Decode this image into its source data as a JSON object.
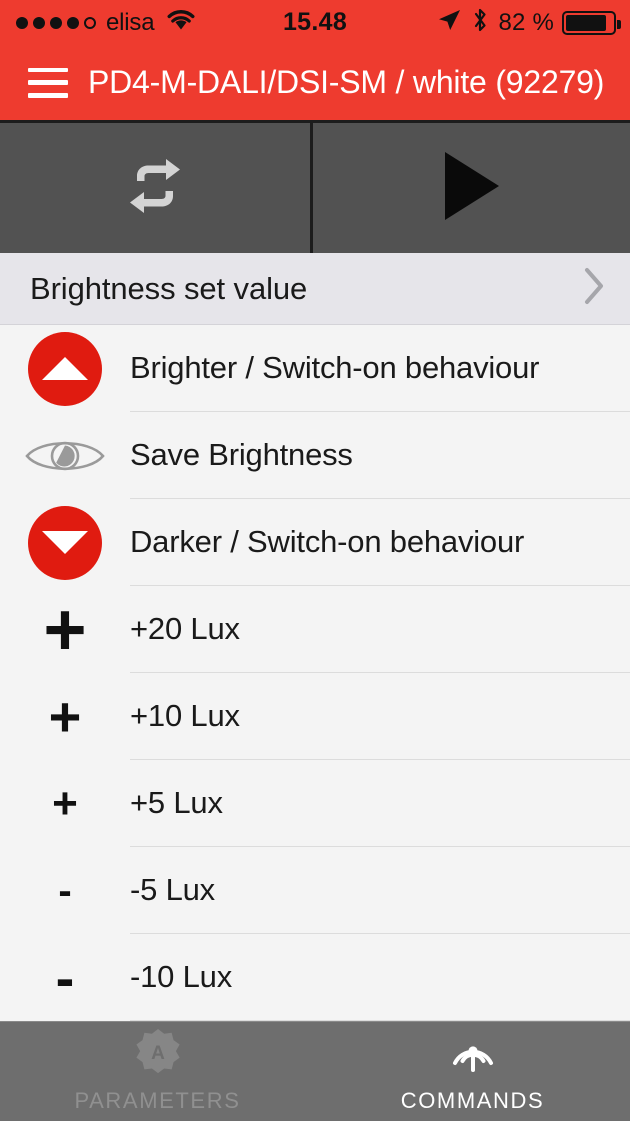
{
  "status_bar": {
    "carrier": "elisa",
    "signal_dots_filled": 4,
    "signal_dots_total": 5,
    "wifi_icon": "wifi-icon",
    "time": "15.48",
    "location_icon": "location-arrow-icon",
    "bluetooth_icon": "bluetooth-icon",
    "battery_percent": "82 %",
    "battery_level": 82,
    "background_color": "#ee3b2f"
  },
  "header": {
    "menu_icon": "hamburger-menu-icon",
    "title": "PD4-M-DALI/DSI-SM / white  (92279)",
    "background_color": "#ee3b2f",
    "text_color": "#ffffff"
  },
  "control_bar": {
    "background_color": "#525252",
    "buttons": [
      {
        "name": "repeat-button",
        "icon": "repeat-icon",
        "icon_color": "#d4d4d4"
      },
      {
        "name": "play-button",
        "icon": "play-icon",
        "icon_color": "#0a0a0a"
      }
    ]
  },
  "section_header": {
    "label": "Brightness set value",
    "chevron_icon": "chevron-right-icon",
    "background_color": "#e6e5ea"
  },
  "command_list": {
    "background_color": "#f4f4f4",
    "items": [
      {
        "label": "Brighter / Switch-on behaviour",
        "icon": "red-circle-up-triangle-icon",
        "icon_type": "circle-up",
        "icon_color": "#e01b10"
      },
      {
        "label": "Save Brightness",
        "icon": "eye-icon",
        "icon_type": "eye",
        "icon_color": "#9a9a9a"
      },
      {
        "label": "Darker / Switch-on behaviour",
        "icon": "red-circle-down-triangle-icon",
        "icon_type": "circle-down",
        "icon_color": "#e01b10"
      },
      {
        "label": "+20 Lux",
        "icon": "plus-icon",
        "icon_type": "plus-xl",
        "icon_color": "#111111"
      },
      {
        "label": "+10 Lux",
        "icon": "plus-icon",
        "icon_type": "plus-lg",
        "icon_color": "#111111"
      },
      {
        "label": "+5 Lux",
        "icon": "plus-icon",
        "icon_type": "plus-md",
        "icon_color": "#111111"
      },
      {
        "label": "-5 Lux",
        "icon": "minus-icon",
        "icon_type": "minus-sm",
        "icon_color": "#111111"
      },
      {
        "label": "-10 Lux",
        "icon": "minus-icon",
        "icon_type": "minus-lg",
        "icon_color": "#111111"
      }
    ]
  },
  "tab_bar": {
    "background_color": "#6e6e6e",
    "tabs": [
      {
        "label": "PARAMETERS",
        "icon": "parameters-badge-a-icon",
        "active": false,
        "color": "#909090"
      },
      {
        "label": "COMMANDS",
        "icon": "broadcast-icon",
        "active": true,
        "color": "#ffffff"
      }
    ]
  }
}
